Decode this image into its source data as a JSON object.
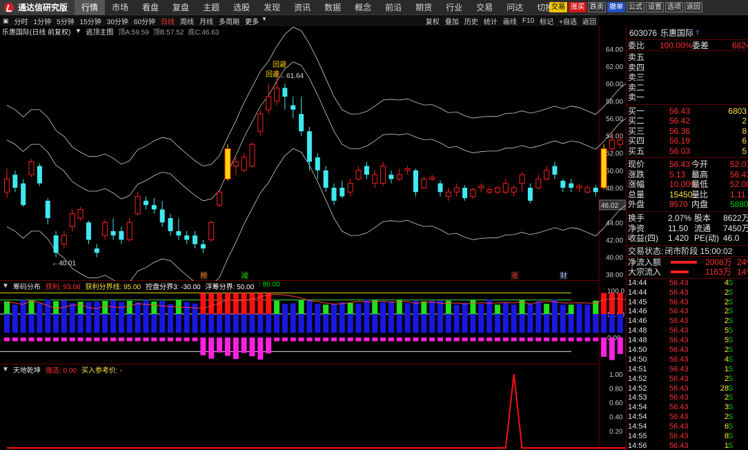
{
  "app": {
    "name": "通达信研究版"
  },
  "menu": [
    "行情",
    "市场",
    "看盘",
    "复盘",
    "主题",
    "选股",
    "发现",
    "资讯",
    "数据",
    "概念",
    "前沿",
    "期货",
    "行业",
    "交易",
    "问达",
    "切换"
  ],
  "menu_active": 0,
  "top_buttons": [
    {
      "label": "交易",
      "style": "yellow"
    },
    {
      "label": "涨买",
      "style": "red"
    },
    {
      "label": "跌卖",
      "style": "dark"
    },
    {
      "label": "撤单",
      "style": "blue"
    },
    {
      "label": "公式",
      "style": "dark"
    },
    {
      "label": "设置",
      "style": "dark"
    },
    {
      "label": "选项",
      "style": "dark"
    },
    {
      "label": "返回",
      "style": "dark"
    }
  ],
  "periods": [
    "分时",
    "1分钟",
    "5分钟",
    "15分钟",
    "30分钟",
    "60分钟",
    "日线",
    "周线",
    "月线",
    "多周期",
    "更多"
  ],
  "period_selected": "日线",
  "right_tools": [
    "复权",
    "叠加",
    "历史",
    "统计",
    "画线",
    "F10",
    "标记",
    "+自选",
    "返回"
  ],
  "main_chart": {
    "stock": "乐惠国际(日线 前复权)",
    "indicator": "逃顶主图",
    "params": [
      {
        "label": "顶A:",
        "value": "59.59"
      },
      {
        "label": "顶B:",
        "value": "57.52"
      },
      {
        "label": "底C:",
        "value": "46.63"
      }
    ],
    "price_axis": [
      "64.00",
      "62.00",
      "60.00",
      "58.00",
      "56.00",
      "54.00",
      "52.00",
      "50.00",
      "48.00",
      "46.00",
      "44.00",
      "42.00",
      "40.00",
      "38.00"
    ],
    "current_price_tag": "46.02",
    "high_label": "61.64",
    "low_label": "40.01",
    "markers": [
      {
        "text": "回避"
      },
      {
        "text": "回避"
      }
    ],
    "bottom_tags": [
      {
        "text": "榜",
        "color": "#ff8000"
      },
      {
        "text": "减",
        "color": "#00e000"
      },
      {
        "text": "涨",
        "color": "#ff3030"
      },
      {
        "text": "财",
        "color": "#a0c0ff"
      }
    ]
  },
  "pane2": {
    "name": "筹码分布",
    "items": [
      {
        "label": "获利:",
        "value": "93.08",
        "color": "#ff3030"
      },
      {
        "label": "获利分界线:",
        "value": "95.00",
        "color": "#ffe040"
      },
      {
        "label": "控盘分界3:",
        "value": "-30.00",
        "color": "#ffffff"
      },
      {
        "label": "浮筹分界:",
        "value": "50.00",
        "color": "#ffffff"
      },
      {
        "label": ":",
        "value": "80.00",
        "color": "#00e000"
      }
    ],
    "axis": [
      "100.0",
      "50.00",
      "0.00"
    ]
  },
  "pane3": {
    "name": "天地乾坤",
    "items": [
      {
        "label": "强选:",
        "value": "0.00",
        "color": "#ff3030"
      },
      {
        "label": "买入参考价:",
        "value": "-",
        "color": "#ffe040"
      }
    ],
    "axis": [
      "1.00",
      "0.80",
      "0.60",
      "0.40",
      "0.20"
    ]
  },
  "quote": {
    "code": "603076",
    "name": "乐惠国际",
    "weibi_label": "委比",
    "weibi": "100.00%",
    "weicha_label": "委差",
    "weicha": "6824",
    "sells": [
      {
        "label": "卖五"
      },
      {
        "label": "卖四"
      },
      {
        "label": "卖三"
      },
      {
        "label": "卖二"
      },
      {
        "label": "卖一"
      }
    ],
    "buys": [
      {
        "label": "买一",
        "price": "56.43",
        "vol": "6803"
      },
      {
        "label": "买二",
        "price": "56.42",
        "vol": "2"
      },
      {
        "label": "买三",
        "price": "56.36",
        "vol": "8"
      },
      {
        "label": "买四",
        "price": "56.19",
        "vol": "6"
      },
      {
        "label": "买五",
        "price": "56.03",
        "vol": "5"
      }
    ],
    "stats": [
      {
        "l1": "现价",
        "v1": "56.43",
        "c1": "red",
        "l2": "今开",
        "v2": "52.01",
        "c2": "red"
      },
      {
        "l1": "涨跌",
        "v1": "5.13",
        "c1": "red",
        "l2": "最高",
        "v2": "56.43",
        "c2": "red"
      },
      {
        "l1": "涨幅",
        "v1": "10.00%",
        "c1": "red",
        "l2": "最低",
        "v2": "52.00",
        "c2": "red"
      },
      {
        "l1": "总量",
        "v1": "15450",
        "c1": "yel",
        "l2": "量比",
        "v2": "1.11",
        "c2": "red"
      },
      {
        "l1": "外盘",
        "v1": "9570",
        "c1": "red",
        "l2": "内盘",
        "v2": "5880",
        "c2": "grn"
      }
    ],
    "stats2": [
      {
        "l1": "换手",
        "v1": "2.07%",
        "l2": "股本",
        "v2": "8622万"
      },
      {
        "l1": "净资",
        "v1": "11.50",
        "l2": "流通",
        "v2": "7450万"
      },
      {
        "l1": "收益(四)",
        "v1": "1.420",
        "l2": "PE(动)",
        "v2": "46.0"
      }
    ],
    "trade_state_label": "交易状态:",
    "trade_state": "闭市阶段 15:00:02",
    "flows": [
      {
        "label": "净流入额",
        "value": "2008万",
        "extra": "24%"
      },
      {
        "label": "大宗流入",
        "value": "1163万",
        "extra": "14%"
      }
    ],
    "ticks": [
      {
        "t": "14:44",
        "p": "56.43",
        "v": "4",
        "s": "S"
      },
      {
        "t": "14:44",
        "p": "56.43",
        "v": "2",
        "s": "S"
      },
      {
        "t": "14:45",
        "p": "56.43",
        "v": "2",
        "s": "S"
      },
      {
        "t": "14:46",
        "p": "56.43",
        "v": "2",
        "s": "S"
      },
      {
        "t": "14:46",
        "p": "56.43",
        "v": "2",
        "s": "S"
      },
      {
        "t": "14:48",
        "p": "56.43",
        "v": "5",
        "s": "S"
      },
      {
        "t": "14:48",
        "p": "56.43",
        "v": "5",
        "s": "S"
      },
      {
        "t": "14:50",
        "p": "56.43",
        "v": "2",
        "s": "S"
      },
      {
        "t": "14:50",
        "p": "56.43",
        "v": "4",
        "s": "S"
      },
      {
        "t": "14:51",
        "p": "56.43",
        "v": "1",
        "s": "S"
      },
      {
        "t": "14:52",
        "p": "56.43",
        "v": "2",
        "s": "S"
      },
      {
        "t": "14:52",
        "p": "56.43",
        "v": "28",
        "s": "S"
      },
      {
        "t": "14:53",
        "p": "56.43",
        "v": "2",
        "s": "S"
      },
      {
        "t": "14:54",
        "p": "56.43",
        "v": "3",
        "s": "S"
      },
      {
        "t": "14:54",
        "p": "56.43",
        "v": "2",
        "s": "S"
      },
      {
        "t": "14:54",
        "p": "56.43",
        "v": "6",
        "s": "S"
      },
      {
        "t": "14:55",
        "p": "56.43",
        "v": "8",
        "s": "S"
      },
      {
        "t": "14:56",
        "p": "56.43",
        "v": "1",
        "s": "S"
      },
      {
        "t": "14:56",
        "p": "56.43",
        "v": "2",
        "s": "S"
      },
      {
        "t": "14:56",
        "p": "56.43",
        "v": "1",
        "s": "S"
      }
    ]
  },
  "chart_data": {
    "type": "candlestick",
    "price_range": [
      37.5,
      65.5
    ],
    "candles": [
      [
        47.5,
        49.0,
        50.2,
        46.8
      ],
      [
        49.5,
        48.0,
        50.0,
        47.5
      ],
      [
        48.5,
        46.0,
        49.0,
        45.8
      ],
      [
        49.5,
        51.0,
        51.3,
        49.2
      ],
      [
        50.5,
        48.5,
        50.8,
        48.2
      ],
      [
        46.5,
        44.5,
        46.8,
        43.8
      ],
      [
        42.5,
        40.5,
        43.0,
        40.0
      ],
      [
        41.5,
        42.5,
        43.0,
        41.0
      ],
      [
        43.5,
        45.0,
        45.5,
        43.0
      ],
      [
        44.5,
        45.5,
        45.8,
        44.2
      ],
      [
        44.0,
        42.0,
        44.2,
        41.5
      ],
      [
        41.0,
        40.5,
        41.5,
        40.0
      ],
      [
        42.5,
        44.0,
        44.3,
        42.0
      ],
      [
        43.0,
        42.5,
        44.5,
        42.0
      ],
      [
        43.0,
        42.0,
        43.5,
        41.5
      ],
      [
        42.0,
        44.0,
        44.5,
        41.8
      ],
      [
        45.0,
        47.0,
        47.5,
        44.8
      ],
      [
        46.5,
        46.0,
        47.0,
        45.5
      ],
      [
        46.0,
        45.5,
        46.8,
        45.0
      ],
      [
        45.5,
        44.0,
        46.5,
        43.5
      ],
      [
        44.5,
        43.0,
        45.0,
        42.5
      ],
      [
        43.0,
        42.5,
        44.5,
        42.0
      ],
      [
        42.5,
        42.0,
        43.0,
        41.5
      ],
      [
        42.5,
        41.5,
        43.0,
        41.0
      ],
      [
        41.5,
        41.0,
        42.0,
        40.5
      ],
      [
        42.0,
        44.0,
        44.2,
        41.8
      ],
      [
        46.0,
        47.5,
        47.8,
        45.8
      ],
      [
        49.0,
        52.5,
        53.0,
        48.8
      ],
      [
        50.5,
        51.0,
        51.5,
        49.5
      ],
      [
        50.0,
        51.5,
        52.0,
        49.8
      ],
      [
        50.5,
        53.0,
        53.2,
        50.3
      ],
      [
        54.5,
        56.5,
        57.0,
        54.0
      ],
      [
        57.0,
        58.5,
        60.0,
        56.5
      ],
      [
        58.0,
        59.5,
        61.6,
        57.5
      ],
      [
        59.5,
        58.5,
        60.0,
        57.0
      ],
      [
        57.5,
        57.0,
        58.5,
        56.0
      ],
      [
        56.5,
        54.5,
        58.5,
        54.0
      ],
      [
        54.5,
        51.0,
        55.0,
        50.0
      ],
      [
        51.5,
        50.0,
        52.0,
        49.0
      ],
      [
        50.0,
        48.0,
        50.5,
        47.5
      ],
      [
        48.0,
        46.5,
        48.5,
        46.0
      ],
      [
        48.0,
        47.0,
        48.8,
        46.8
      ],
      [
        47.5,
        48.5,
        49.0,
        47.0
      ],
      [
        49.0,
        50.0,
        50.5,
        48.8
      ],
      [
        50.5,
        49.5,
        51.0,
        49.0
      ],
      [
        48.5,
        49.5,
        50.0,
        48.0
      ],
      [
        48.5,
        50.5,
        51.0,
        48.2
      ],
      [
        49.5,
        49.0,
        50.0,
        48.5
      ],
      [
        49.0,
        49.5,
        50.2,
        48.8
      ],
      [
        50.0,
        50.2,
        50.5,
        49.5
      ],
      [
        50.0,
        47.5,
        50.2,
        47.0
      ],
      [
        48.0,
        49.0,
        49.3,
        47.8
      ],
      [
        49.0,
        49.2,
        49.5,
        48.8
      ],
      [
        48.5,
        47.5,
        48.8,
        47.0
      ],
      [
        47.0,
        47.5,
        48.0,
        46.5
      ],
      [
        47.5,
        48.0,
        48.5,
        47.0
      ],
      [
        48.0,
        46.8,
        48.3,
        46.5
      ],
      [
        47.0,
        47.8,
        48.0,
        46.7
      ],
      [
        48.0,
        48.2,
        48.5,
        47.5
      ],
      [
        47.5,
        47.8,
        48.0,
        47.3
      ],
      [
        47.5,
        48.0,
        48.2,
        47.2
      ],
      [
        47.5,
        48.5,
        49.0,
        47.2
      ],
      [
        47.5,
        48.0,
        48.3,
        47.0
      ],
      [
        48.5,
        49.5,
        49.8,
        47.5
      ],
      [
        48.0,
        46.5,
        48.5,
        46.2
      ],
      [
        48.0,
        49.0,
        49.5,
        47.8
      ],
      [
        49.0,
        50.0,
        50.5,
        48.8
      ],
      [
        50.5,
        49.5,
        51.0,
        49.0
      ],
      [
        48.8,
        48.0,
        49.0,
        47.5
      ],
      [
        48.5,
        48.0,
        49.0,
        47.5
      ],
      [
        48.0,
        48.2,
        48.5,
        47.5
      ],
      [
        47.5,
        48.0,
        48.3,
        47.3
      ],
      [
        48.0,
        47.5,
        48.3,
        47.0
      ],
      [
        48.0,
        52.5,
        53.0,
        47.8
      ],
      [
        52.5,
        53.5,
        54.5,
        52.0
      ],
      [
        53.0,
        53.5,
        54.3,
        52.5
      ],
      [
        53.5,
        51.5,
        53.8,
        51.0
      ],
      [
        51.5,
        51.0,
        52.0,
        50.5
      ],
      [
        51.0,
        49.5,
        51.5,
        48.5
      ],
      [
        50.5,
        51.0,
        51.5,
        50.0
      ],
      [
        52.0,
        56.5,
        56.5,
        52.0
      ]
    ]
  }
}
